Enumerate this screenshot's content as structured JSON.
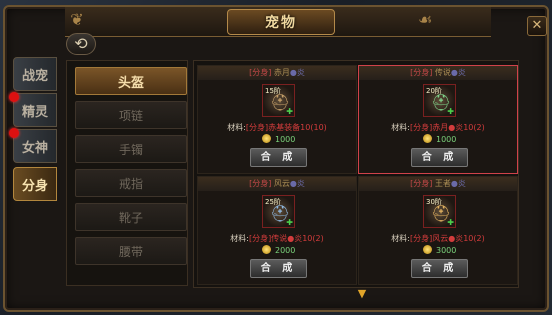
{
  "window": {
    "title": "宠物",
    "close_icon": "close-icon",
    "back_icon": "back-arrow-icon"
  },
  "side_tabs": [
    {
      "label": "战宠",
      "active": false,
      "alert": false
    },
    {
      "label": "精灵",
      "active": false,
      "alert": true
    },
    {
      "label": "女神",
      "active": false,
      "alert": true
    },
    {
      "label": "分身",
      "active": true,
      "alert": false
    }
  ],
  "slots": [
    {
      "label": "头盔",
      "active": true
    },
    {
      "label": "项链",
      "active": false
    },
    {
      "label": "手镯",
      "active": false
    },
    {
      "label": "戒指",
      "active": false
    },
    {
      "label": "靴子",
      "active": false
    },
    {
      "label": "腰带",
      "active": false
    }
  ],
  "cards": [
    {
      "tag": "[分身]",
      "name": "赤月",
      "stars": "●炎",
      "level": "15阶",
      "material_label": "材料:",
      "material_tag": "[分身]",
      "material_name": "赤基装备",
      "material_count": "10(10)",
      "cost": "1000",
      "action": "合 成",
      "selected": false
    },
    {
      "tag": "[分身]",
      "name": "传说",
      "stars": "●炎",
      "level": "20阶",
      "material_label": "材料:",
      "material_tag": "[分身]",
      "material_name": "赤月",
      "material_count": "●炎10(2)",
      "cost": "1000",
      "action": "合 成",
      "selected": true
    },
    {
      "tag": "[分身]",
      "name": "风云",
      "stars": "●炎",
      "level": "25阶",
      "material_label": "材料:",
      "material_tag": "[分身]",
      "material_name": "传说",
      "material_count": "●炎10(2)",
      "cost": "2000",
      "action": "合 成",
      "selected": false
    },
    {
      "tag": "[分身]",
      "name": "王者",
      "stars": "●炎",
      "level": "30阶",
      "material_label": "材料:",
      "material_tag": "[分身]",
      "material_name": "风云",
      "material_count": "●炎10(2)",
      "cost": "3000",
      "action": "合 成",
      "selected": false
    }
  ],
  "colors": {
    "accent": "#b3873d",
    "selected_border": "#d0424a",
    "alert_dot": "#dd1111"
  }
}
